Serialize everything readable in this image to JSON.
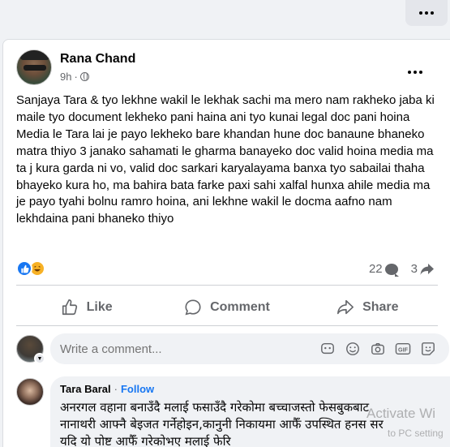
{
  "post": {
    "author": "Rana Chand",
    "time": "9h",
    "text": "Sanjaya Tara & tyo lekhne wakil le lekhak sachi ma mero nam rakheko jaba ki maile tyo document lekheko pani haina ani tyo kunai legal doc pani hoina Media le Tara lai je payo lekheko bare khandan hune doc banaune bhaneko matra thiyo 3 janako sahamati le gharma banayeko doc valid hoina media ma ta j kura garda ni vo, valid doc sarkari karyalayama banxa tyo sabailai thaha bhayeko kura ho, ma bahira bata farke paxi sahi xalfal hunxa ahile media ma je payo tyahi bolnu ramro hoina, ani lekhne wakil le docma aafno nam lekhdaina pani bhaneko thiyo",
    "comment_count": "22",
    "share_count": "3"
  },
  "actions": {
    "like": "Like",
    "comment": "Comment",
    "share": "Share"
  },
  "comment_box": {
    "placeholder": "Write a comment..."
  },
  "reply": {
    "author": "Tara Baral",
    "separator": "·",
    "follow": "Follow",
    "text": "अनरगल वहाना बनाउँदै मलाई फसाउँदै गरेकोमा बच्चाजस्तो फेसबुकबाट नानाथरी आफ्नै बेइजत गर्नेहोइन,कानुनी निकायमा आफैँ उपस्थित हनस सर यदि यो पोष्ट आफैँ गरेकोभए मलाई फेरि"
  },
  "watermark": {
    "title": "Activate Wi",
    "sub": "to PC setting"
  },
  "colors": {
    "accent": "#1877f2",
    "muted": "#65676b",
    "haha": "#f7b125"
  }
}
